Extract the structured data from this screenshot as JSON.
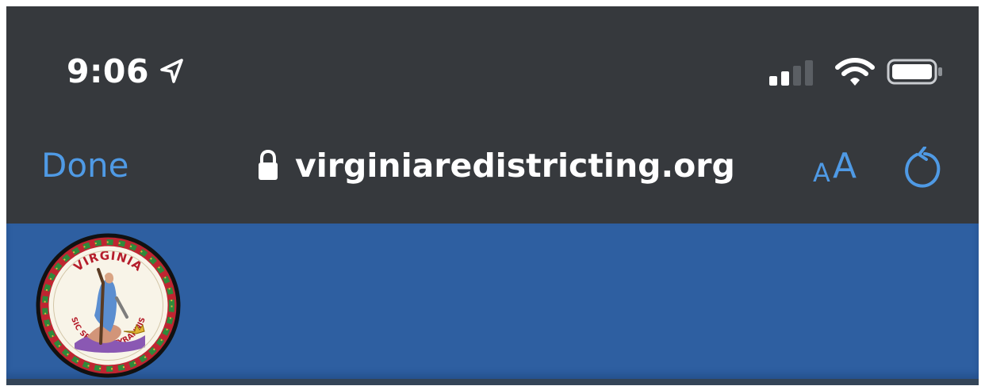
{
  "status_bar": {
    "time": "9:06",
    "icons": {
      "location": "location-arrow-icon",
      "signal": "cellular-signal-icon",
      "wifi": "wifi-icon",
      "battery": "battery-icon"
    }
  },
  "browser": {
    "done_label": "Done",
    "secure_icon": "lock-icon",
    "domain": "virginiaredistricting.org",
    "text_size": {
      "small": "A",
      "large": "A"
    },
    "reload_icon": "reload-icon"
  },
  "site": {
    "logo": {
      "name": "virginia-state-seal",
      "top_text": "VIRGINIA",
      "motto": "SIC SEMPER TYRANNIS"
    }
  },
  "colors": {
    "browser_chrome": "#36393d",
    "accent": "#4f9ae5",
    "site_header": "#2e5fa1",
    "text_light": "#ffffff"
  }
}
